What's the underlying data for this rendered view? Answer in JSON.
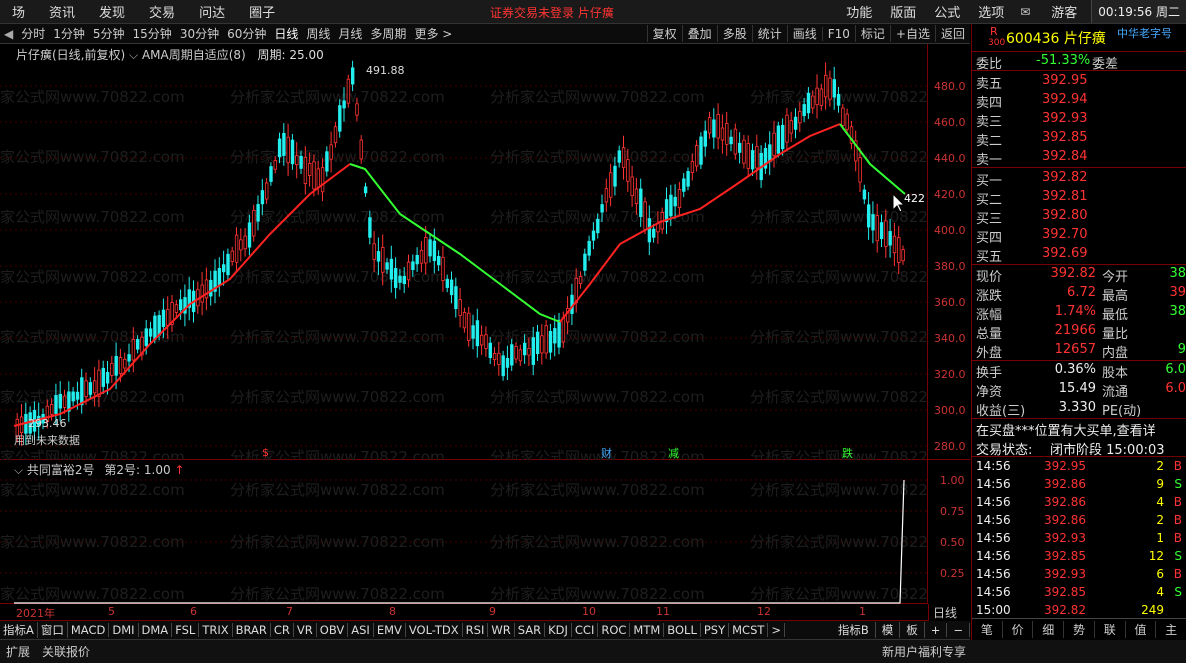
{
  "menu": {
    "items": [
      "场",
      "资讯",
      "发现",
      "交易",
      "问达",
      "圈子"
    ],
    "status_text": "证券交易未登录  片仔癀",
    "right_items": [
      "功能",
      "版面",
      "公式",
      "选项"
    ],
    "user": "游客",
    "clock": "00:19:56 周二"
  },
  "toolbar": {
    "periods": [
      "分时",
      "1分钟",
      "5分钟",
      "15分钟",
      "30分钟",
      "60分钟",
      "日线",
      "周线",
      "月线",
      "多周期",
      "更多 >"
    ],
    "active_period": "日线",
    "right_items": [
      "复权",
      "叠加",
      "多股",
      "统计",
      "画线",
      "F10",
      "标记",
      "+自选",
      "返回"
    ]
  },
  "main_chart": {
    "title": "片仔癀(日线,前复权)",
    "indicator": "AMA周期自适应(8)",
    "period_label": "周期: 25.00",
    "high_label": "491.88",
    "low_label": "293.46",
    "future_label": "用到未来数据",
    "current_label": "422",
    "y_ticks": [
      "480.0",
      "460.0",
      "440.0",
      "420.0",
      "400.0",
      "380.0",
      "360.0",
      "340.0",
      "320.0",
      "300.0",
      "280.0"
    ],
    "markers": [
      {
        "text": "$",
        "color": "#f33"
      },
      {
        "text": "财",
        "color": "#4af"
      },
      {
        "text": "减",
        "color": "#3f3"
      },
      {
        "text": "跌",
        "color": "#3f3"
      }
    ]
  },
  "sub_chart": {
    "title": "共同富裕2号",
    "label": "第2号: 1.00",
    "y_ticks": [
      "1.00",
      "0.75",
      "0.50",
      "0.25"
    ]
  },
  "date_axis": {
    "labels": [
      "2021年",
      "5",
      "6",
      "7",
      "8",
      "9",
      "10",
      "11",
      "12",
      "1"
    ],
    "period": "日线"
  },
  "indicator_tabs": [
    "指标A",
    "窗口",
    "MACD",
    "DMI",
    "DMA",
    "FSL",
    "TRIX",
    "BRAR",
    "CR",
    "VR",
    "OBV",
    "ASI",
    "EMV",
    "VOL-TDX",
    "RSI",
    "WR",
    "SAR",
    "KDJ",
    "CCI",
    "ROC",
    "MTM",
    "BOLL",
    "PSY",
    "MCST",
    ">"
  ],
  "indicator_tabs_right": [
    "指标B",
    "模",
    "板",
    "+",
    "−"
  ],
  "bottom_bar": {
    "left": [
      "扩展",
      "关联报价"
    ],
    "right": "新用户福利专享"
  },
  "quote": {
    "code": "600436",
    "name": "片仔癀",
    "r_label": "R",
    "num300": "300",
    "site": "中华老字号",
    "weibi_label": "委比",
    "weibi": "-51.33%",
    "weicha_label": "委差",
    "weicha": "",
    "asks": [
      {
        "label": "卖五",
        "price": "392.95"
      },
      {
        "label": "卖四",
        "price": "392.94"
      },
      {
        "label": "卖三",
        "price": "392.93"
      },
      {
        "label": "卖二",
        "price": "392.85"
      },
      {
        "label": "卖一",
        "price": "392.84"
      }
    ],
    "bids": [
      {
        "label": "买一",
        "price": "392.82"
      },
      {
        "label": "买二",
        "price": "392.81"
      },
      {
        "label": "买三",
        "price": "392.80"
      },
      {
        "label": "买四",
        "price": "392.70"
      },
      {
        "label": "买五",
        "price": "392.69"
      }
    ],
    "stats": [
      {
        "l": "现价",
        "v": "392.82",
        "l2": "今开",
        "v2": "38"
      },
      {
        "l": "涨跌",
        "v": "6.72",
        "l2": "最高",
        "v2": "39"
      },
      {
        "l": "涨幅",
        "v": "1.74%",
        "l2": "最低",
        "v2": "38"
      },
      {
        "l": "总量",
        "v": "21966",
        "l2": "量比",
        "v2": ""
      },
      {
        "l": "外盘",
        "v": "12657",
        "l2": "内盘",
        "v2": "9"
      }
    ],
    "stats2": [
      {
        "l": "换手",
        "v": "0.36%",
        "l2": "股本",
        "v2": "6.0"
      },
      {
        "l": "净资",
        "v": "15.49",
        "l2": "流通",
        "v2": "6.0"
      },
      {
        "l": "收益(三)",
        "v": "3.330",
        "l2": "PE(动)",
        "v2": ""
      }
    ],
    "notice": "在买盘***位置有大买单,查看详",
    "trade_status_label": "交易状态:",
    "trade_status": "闭市阶段 15:00:03",
    "ticks": [
      {
        "t": "14:56",
        "p": "392.95",
        "q": "2",
        "s": "B"
      },
      {
        "t": "14:56",
        "p": "392.86",
        "q": "9",
        "s": "S"
      },
      {
        "t": "14:56",
        "p": "392.86",
        "q": "4",
        "s": "B"
      },
      {
        "t": "14:56",
        "p": "392.86",
        "q": "2",
        "s": "B"
      },
      {
        "t": "14:56",
        "p": "392.93",
        "q": "1",
        "s": "B"
      },
      {
        "t": "14:56",
        "p": "392.85",
        "q": "12",
        "s": "S"
      },
      {
        "t": "14:56",
        "p": "392.93",
        "q": "6",
        "s": "B"
      },
      {
        "t": "14:56",
        "p": "392.85",
        "q": "4",
        "s": "S"
      },
      {
        "t": "15:00",
        "p": "392.82",
        "q": "249",
        "s": ""
      }
    ],
    "bottom_tabs": [
      "笔",
      "价",
      "细",
      "势",
      "联",
      "值",
      "主"
    ]
  }
}
